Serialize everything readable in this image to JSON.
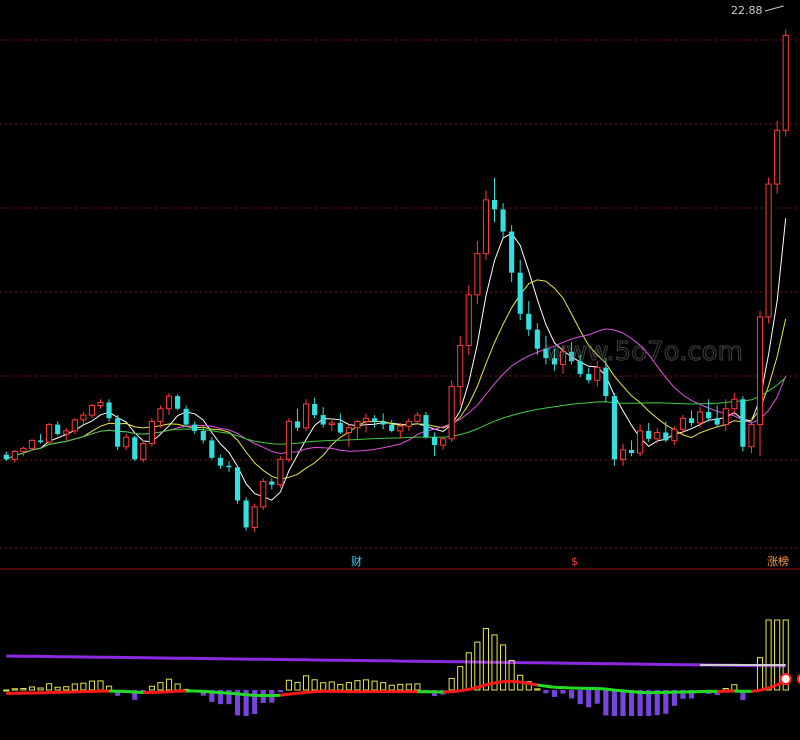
{
  "chart_data": [
    {
      "type": "candlestick",
      "panel": "main",
      "max_price_label": "22.88",
      "ylim": [
        6.5,
        23.5
      ],
      "grid": "dotted-horizontal",
      "colors": {
        "up": "#ff3a3a",
        "down": "#33e0e0",
        "ma_fast": "#ffffff",
        "ma_mid": "#e6e64a",
        "ma_slow": "#e050e0",
        "ma_long": "#40cc40",
        "grid": "#8a1010"
      },
      "candles": [
        [
          9.45,
          9.55,
          9.25,
          9.3
        ],
        [
          9.3,
          9.6,
          9.2,
          9.55
        ],
        [
          9.55,
          9.7,
          9.4,
          9.65
        ],
        [
          9.65,
          9.95,
          9.6,
          9.9
        ],
        [
          9.9,
          10.1,
          9.8,
          9.85
        ],
        [
          9.85,
          10.45,
          9.8,
          10.4
        ],
        [
          10.4,
          10.5,
          10.05,
          10.1
        ],
        [
          10.1,
          10.3,
          9.9,
          10.2
        ],
        [
          10.2,
          10.6,
          10.1,
          10.55
        ],
        [
          10.55,
          10.8,
          10.4,
          10.7
        ],
        [
          10.7,
          11.05,
          10.6,
          11.0
        ],
        [
          11.0,
          11.2,
          10.9,
          11.1
        ],
        [
          11.1,
          11.2,
          10.5,
          10.6
        ],
        [
          10.6,
          10.7,
          9.6,
          9.7
        ],
        [
          9.7,
          10.1,
          9.6,
          10.0
        ],
        [
          10.0,
          10.05,
          9.25,
          9.3
        ],
        [
          9.3,
          9.9,
          9.2,
          9.8
        ],
        [
          9.8,
          10.6,
          9.7,
          10.5
        ],
        [
          10.5,
          11.0,
          10.3,
          10.9
        ],
        [
          10.9,
          11.4,
          10.7,
          11.3
        ],
        [
          11.3,
          11.35,
          10.85,
          10.9
        ],
        [
          10.9,
          11.0,
          10.35,
          10.4
        ],
        [
          10.4,
          10.5,
          10.1,
          10.2
        ],
        [
          10.2,
          10.3,
          9.8,
          9.9
        ],
        [
          9.9,
          10.0,
          9.3,
          9.35
        ],
        [
          9.35,
          9.45,
          9.0,
          9.1
        ],
        [
          9.1,
          9.25,
          8.9,
          9.05
        ],
        [
          9.05,
          9.1,
          7.9,
          8.0
        ],
        [
          8.0,
          8.1,
          7.05,
          7.15
        ],
        [
          7.15,
          7.9,
          7.0,
          7.8
        ],
        [
          7.8,
          8.7,
          7.7,
          8.6
        ],
        [
          8.6,
          8.7,
          8.35,
          8.5
        ],
        [
          8.5,
          9.4,
          8.4,
          9.3
        ],
        [
          9.3,
          10.6,
          9.2,
          10.5
        ],
        [
          10.5,
          10.9,
          10.2,
          10.3
        ],
        [
          10.3,
          11.2,
          10.2,
          11.05
        ],
        [
          11.05,
          11.25,
          10.6,
          10.7
        ],
        [
          10.7,
          10.95,
          10.3,
          10.4
        ],
        [
          10.4,
          10.6,
          10.2,
          10.45
        ],
        [
          10.45,
          10.75,
          10.1,
          10.15
        ],
        [
          10.15,
          10.4,
          9.7,
          10.3
        ],
        [
          10.3,
          10.55,
          9.9,
          10.5
        ],
        [
          10.5,
          10.75,
          10.15,
          10.6
        ],
        [
          10.6,
          10.7,
          10.3,
          10.5
        ],
        [
          10.5,
          10.75,
          10.25,
          10.4
        ],
        [
          10.4,
          10.55,
          10.15,
          10.2
        ],
        [
          10.2,
          10.45,
          9.95,
          10.35
        ],
        [
          10.35,
          10.6,
          10.2,
          10.5
        ],
        [
          10.5,
          10.8,
          10.4,
          10.7
        ],
        [
          10.7,
          10.8,
          9.95,
          10.0
        ],
        [
          10.0,
          10.15,
          9.4,
          9.75
        ],
        [
          9.75,
          10.0,
          9.6,
          9.95
        ],
        [
          9.95,
          11.8,
          9.85,
          11.6
        ],
        [
          11.6,
          13.2,
          11.0,
          12.9
        ],
        [
          12.9,
          14.8,
          12.6,
          14.5
        ],
        [
          14.5,
          16.2,
          14.2,
          15.8
        ],
        [
          15.8,
          17.8,
          15.6,
          17.5
        ],
        [
          17.5,
          18.2,
          16.8,
          17.2
        ],
        [
          17.2,
          17.4,
          16.3,
          16.5
        ],
        [
          16.5,
          16.7,
          14.9,
          15.2
        ],
        [
          15.2,
          15.6,
          13.7,
          13.9
        ],
        [
          13.9,
          14.3,
          13.2,
          13.4
        ],
        [
          13.4,
          13.6,
          12.6,
          12.8
        ],
        [
          12.8,
          13.2,
          12.3,
          12.5
        ],
        [
          12.5,
          12.8,
          12.1,
          12.3
        ],
        [
          12.3,
          12.9,
          12.0,
          12.7
        ],
        [
          12.7,
          13.0,
          12.3,
          12.4
        ],
        [
          12.4,
          12.6,
          11.9,
          12.0
        ],
        [
          12.0,
          12.2,
          11.7,
          11.8
        ],
        [
          11.8,
          12.4,
          11.6,
          12.2
        ],
        [
          12.2,
          12.5,
          11.1,
          11.3
        ],
        [
          11.3,
          11.4,
          9.1,
          9.3
        ],
        [
          9.3,
          9.8,
          9.1,
          9.6
        ],
        [
          9.6,
          9.9,
          9.4,
          9.5
        ],
        [
          9.5,
          10.4,
          9.4,
          10.2
        ],
        [
          10.2,
          10.45,
          9.85,
          9.95
        ],
        [
          9.95,
          10.3,
          9.8,
          10.15
        ],
        [
          10.15,
          10.5,
          9.85,
          9.9
        ],
        [
          9.9,
          10.35,
          9.75,
          10.25
        ],
        [
          10.25,
          10.7,
          10.1,
          10.6
        ],
        [
          10.6,
          10.85,
          10.35,
          10.45
        ],
        [
          10.45,
          10.95,
          10.3,
          10.8
        ],
        [
          10.8,
          11.2,
          10.5,
          10.6
        ],
        [
          10.6,
          11.0,
          10.3,
          10.4
        ],
        [
          10.4,
          11.2,
          10.2,
          10.9
        ],
        [
          10.9,
          11.4,
          10.7,
          11.2
        ],
        [
          11.2,
          11.3,
          9.55,
          9.7
        ],
        [
          9.7,
          10.6,
          9.5,
          10.4
        ],
        [
          10.4,
          14.0,
          9.4,
          13.8
        ],
        [
          13.8,
          18.2,
          13.6,
          18.0
        ],
        [
          18.0,
          20.0,
          17.7,
          19.7
        ],
        [
          19.7,
          22.88,
          19.5,
          22.7
        ]
      ],
      "ma_periods": [
        5,
        10,
        20,
        60
      ],
      "markers": [
        {
          "label": "财",
          "color": "#33d6ff",
          "index": 58
        },
        {
          "label": "$",
          "color": "#ff3a3a",
          "index": 95
        },
        {
          "label": "涨榜",
          "color": "#ff9a4a",
          "index": 129
        }
      ]
    },
    {
      "type": "indicator",
      "panel": "sub",
      "colors": {
        "upper_line": "#8a2be2",
        "lower_line_red": "#ff1a1a",
        "lower_line_green": "#22dd22",
        "bar_purple": "#7744dd",
        "bar_yellow": "#e6e64a",
        "white_line": "#cccccc"
      }
    }
  ]
}
